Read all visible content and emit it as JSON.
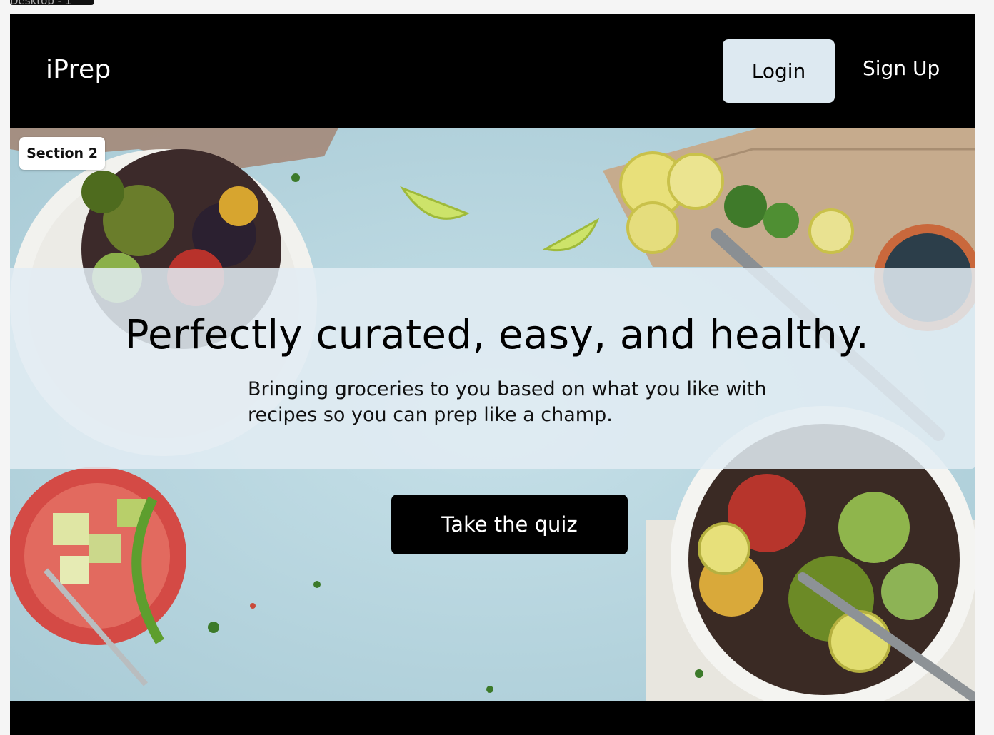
{
  "frame": {
    "label": "Desktop - 1"
  },
  "navbar": {
    "logo": "iPrep",
    "login_label": "Login",
    "signup_label": "Sign Up"
  },
  "hero": {
    "section_badge": "Section 2",
    "headline": "Perfectly curated, easy, and healthy.",
    "subline": "Bringing groceries to you based on what you like with recipes so you can prep like a champ.",
    "cta_label": "Take the quiz",
    "image_description_icons": [
      "salad-bowl-icon",
      "lime-wedge-icon",
      "cutting-board-icon",
      "avocado-bowl-icon",
      "fork-icon"
    ]
  },
  "colors": {
    "navbar_bg": "#000000",
    "login_bg": "#dde9f1",
    "hero_bg": "#bad7e0",
    "overlay_bg": "#e2ecf3",
    "cta_bg": "#000000"
  }
}
